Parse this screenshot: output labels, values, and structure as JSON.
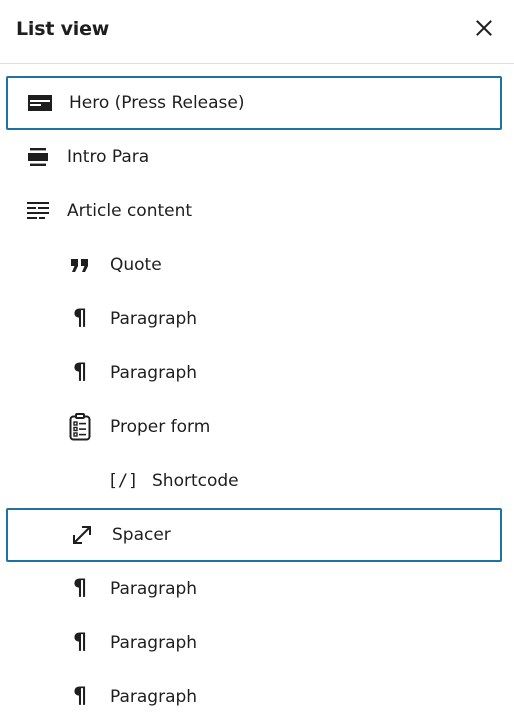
{
  "header": {
    "title": "List view",
    "close_icon": "close-icon"
  },
  "items": [
    {
      "label": "Hero (Press Release)",
      "icon": "cover-block-icon",
      "selected": true
    },
    {
      "label": "Intro Para",
      "icon": "group-block-icon",
      "selected": false
    },
    {
      "label": "Article content",
      "icon": "post-content-icon",
      "selected": false
    },
    {
      "label": "Quote",
      "icon": "quote-icon",
      "selected": false
    },
    {
      "label": "Paragraph",
      "icon": "paragraph-icon",
      "selected": false
    },
    {
      "label": "Paragraph",
      "icon": "paragraph-icon",
      "selected": false
    },
    {
      "label": "Proper form",
      "icon": "form-icon",
      "selected": false
    },
    {
      "label": "Shortcode",
      "icon": "shortcode-icon",
      "icon_text": "[/]",
      "selected": false
    },
    {
      "label": "Spacer",
      "icon": "spacer-icon",
      "selected": true
    },
    {
      "label": "Paragraph",
      "icon": "paragraph-icon",
      "selected": false
    },
    {
      "label": "Paragraph",
      "icon": "paragraph-icon",
      "selected": false
    },
    {
      "label": "Paragraph",
      "icon": "paragraph-icon",
      "selected": false
    }
  ]
}
